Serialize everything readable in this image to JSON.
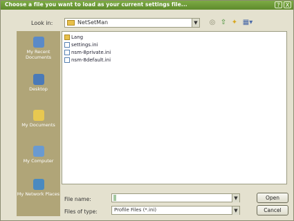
{
  "dialog": {
    "title": "Choose a file you want to load as your current settings file...",
    "close_label": "X",
    "help_label": "?"
  },
  "toolbar": {
    "look_in_label": "Look in:",
    "look_in_value": "NetSetMan",
    "back_icon": "back-arrow-icon",
    "up_icon": "up-folder-icon",
    "new_folder_icon": "new-folder-icon",
    "views_icon": "views-menu-icon"
  },
  "places": [
    {
      "label": "My Recent Documents",
      "icon": "recent-documents-icon",
      "color": "#5a8ac8"
    },
    {
      "label": "Desktop",
      "icon": "desktop-icon",
      "color": "#4a7ab8"
    },
    {
      "label": "My Documents",
      "icon": "my-documents-icon",
      "color": "#e8c850"
    },
    {
      "label": "My Computer",
      "icon": "my-computer-icon",
      "color": "#6a9ad0"
    },
    {
      "label": "My Network Places",
      "icon": "network-places-icon",
      "color": "#4a8ac0"
    }
  ],
  "files": [
    {
      "name": "Lang",
      "type": "folder"
    },
    {
      "name": "settings.ini",
      "type": "file"
    },
    {
      "name": "nsm-8private.ini",
      "type": "file"
    },
    {
      "name": "nsm-8default.ini",
      "type": "file"
    }
  ],
  "form": {
    "filename_label": "File name:",
    "filename_value": "",
    "filetype_label": "Files of type:",
    "filetype_value": "Profile Files (*.ini)",
    "open_label": "Open",
    "cancel_label": "Cancel"
  }
}
